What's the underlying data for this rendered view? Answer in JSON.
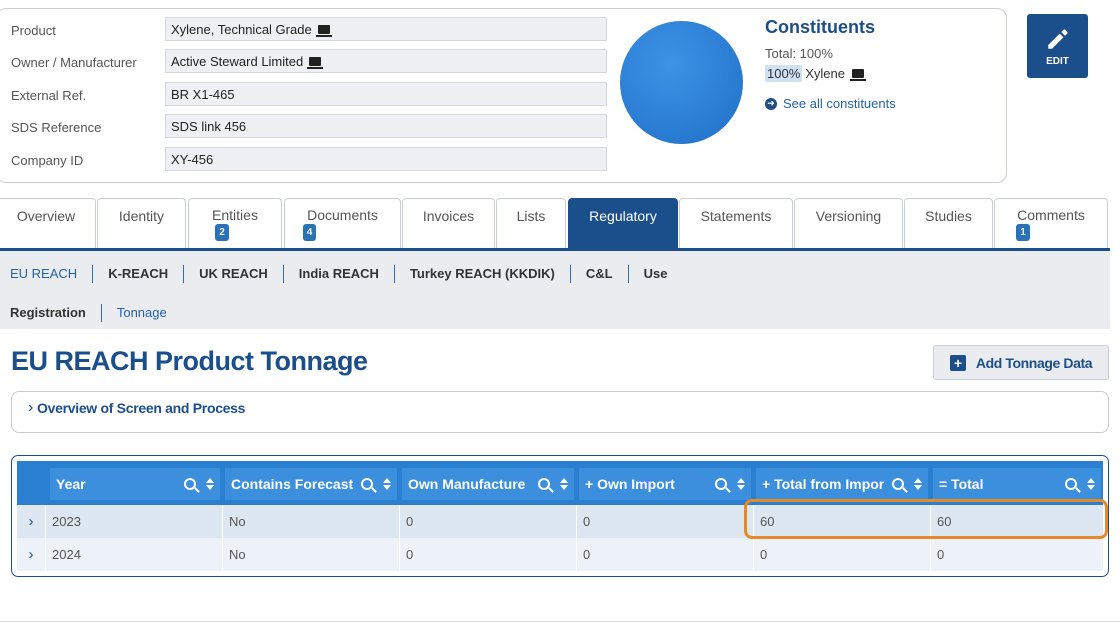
{
  "product_info": {
    "fields": [
      {
        "label": "Product",
        "value": "Xylene, Technical Grade",
        "icon": "laptop-icon"
      },
      {
        "label": "Owner / Manufacturer",
        "value": "Active Steward Limited",
        "icon": "laptop-icon"
      },
      {
        "label": "External Ref.",
        "value": "BR X1-465"
      },
      {
        "label": "SDS Reference",
        "value": "SDS link 456"
      },
      {
        "label": "Company ID",
        "value": "XY-456"
      }
    ]
  },
  "constituents": {
    "title": "Constituents",
    "total": "Total: 100%",
    "items": [
      {
        "percent": "100%",
        "name": "Xylene"
      }
    ],
    "see_all": "See all constituents",
    "pie_color": "#2a7fd6"
  },
  "edit_button": {
    "label": "EDIT"
  },
  "tabs": [
    {
      "label": "Overview"
    },
    {
      "label": "Identity"
    },
    {
      "label": "Entities",
      "badge": "2"
    },
    {
      "label": "Documents",
      "badge": "4"
    },
    {
      "label": "Invoices"
    },
    {
      "label": "Lists"
    },
    {
      "label": "Regulatory",
      "active": true
    },
    {
      "label": "Statements"
    },
    {
      "label": "Versioning"
    },
    {
      "label": "Studies"
    },
    {
      "label": "Comments",
      "badge": "1"
    }
  ],
  "subnav": {
    "row1": [
      "EU REACH",
      "K-REACH",
      "UK REACH",
      "India REACH",
      "Turkey REACH (KKDIK)",
      "C&L",
      "Use"
    ],
    "row2": [
      "Registration",
      "Tonnage"
    ]
  },
  "page_title": "EU REACH Product Tonnage",
  "add_button": {
    "label": "Add Tonnage Data"
  },
  "overview_panel": {
    "label": "Overview of Screen and Process"
  },
  "table": {
    "columns": [
      "Year",
      "Contains Forecast",
      "Own Manufacture",
      "+ Own Import",
      "+ Total from Impor",
      "= Total"
    ],
    "rows": [
      [
        "2023",
        "No",
        "0",
        "0",
        "60",
        "60"
      ],
      [
        "2024",
        "No",
        "0",
        "0",
        "0",
        "0"
      ]
    ]
  },
  "colors": {
    "brand": "#1b4f8c",
    "header": "#2a7fd0",
    "highlight": "#e48a2b"
  }
}
